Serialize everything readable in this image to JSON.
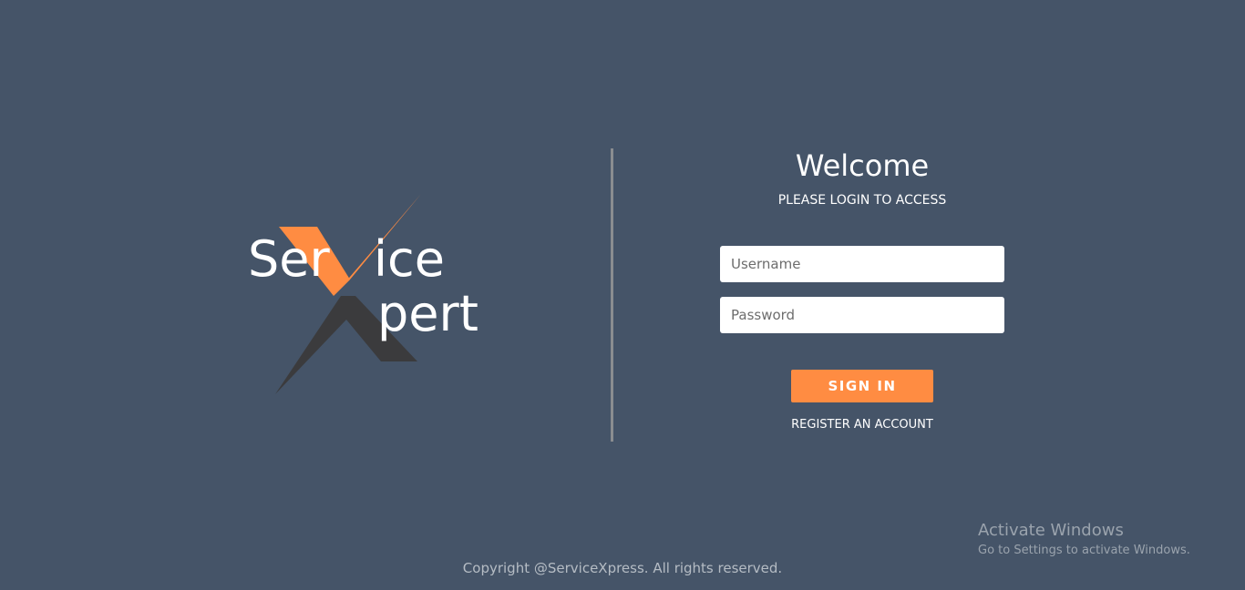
{
  "colors": {
    "background": "#455468",
    "accent": "#ff8c42",
    "logo_dark": "#3b3b3d",
    "logo_text": "#ffffff"
  },
  "logo": {
    "text_line1_left": "Ser",
    "text_line1_right": "ice",
    "text_line2": "pert"
  },
  "login": {
    "title": "Welcome",
    "subtitle": "PLEASE LOGIN TO ACCESS",
    "username_placeholder": "Username",
    "password_placeholder": "Password",
    "signin_label": "SIGN IN",
    "register_label": "REGISTER AN ACCOUNT"
  },
  "footer": {
    "copyright": "Copyright @ServiceXpress. All rights reserved."
  },
  "watermark": {
    "title": "Activate Windows",
    "subtitle": "Go to Settings to activate Windows."
  }
}
